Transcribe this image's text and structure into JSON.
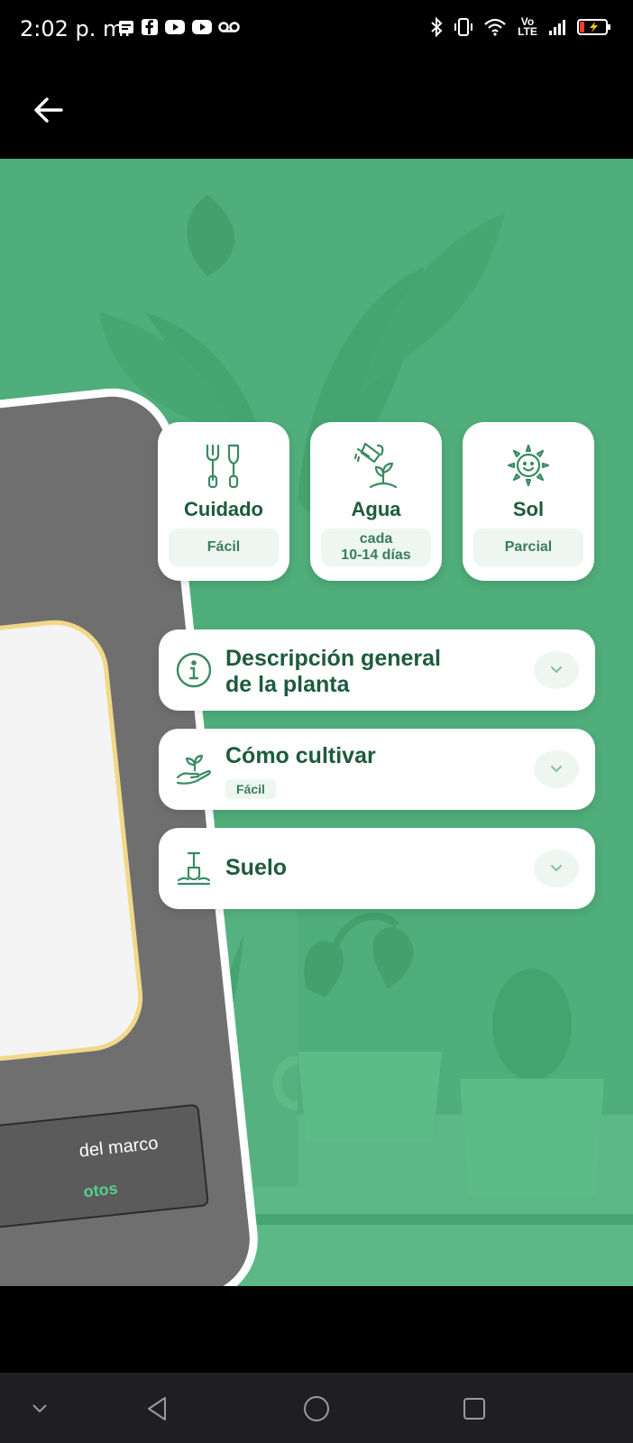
{
  "status_bar": {
    "time": "2:02 p. m.",
    "left_icons": [
      "message-icon",
      "facebook-icon",
      "youtube-icon",
      "youtube-icon",
      "voicemail-icon"
    ],
    "right_icons": [
      "bluetooth-icon",
      "vibrate-icon",
      "wifi-icon",
      "volte-icon",
      "signal-icon",
      "battery-icon"
    ],
    "volte_text": "Vo LTE"
  },
  "app_bar": {
    "back_icon": "arrow-left-icon"
  },
  "phone_mockup": {
    "button_text": "del marco",
    "button_subtext": "otos"
  },
  "stats": [
    {
      "icon": "gardening-tools-icon",
      "title": "Cuidado",
      "value": "Fácil"
    },
    {
      "icon": "watering-can-icon",
      "title": "Agua",
      "value_line1": "cada",
      "value_line2": "10-14 días"
    },
    {
      "icon": "sun-icon",
      "title": "Sol",
      "value": "Parcial"
    }
  ],
  "accordions": [
    {
      "icon": "info-icon",
      "title_line1": "Descripción general",
      "title_line2": "de la planta"
    },
    {
      "icon": "hand-sprout-icon",
      "title": "Cómo cultivar",
      "badge": "Fácil"
    },
    {
      "icon": "shovel-icon",
      "title": "Suelo"
    }
  ],
  "colors": {
    "hero_green": "#4fae7b",
    "title_green": "#1d5b3c",
    "pill_bg": "#eef6f1",
    "card_bg": "#ffffff"
  },
  "nav_bar": {
    "buttons": [
      "chevron-down-icon",
      "back-triangle-icon",
      "home-circle-icon",
      "recents-square-icon"
    ]
  }
}
